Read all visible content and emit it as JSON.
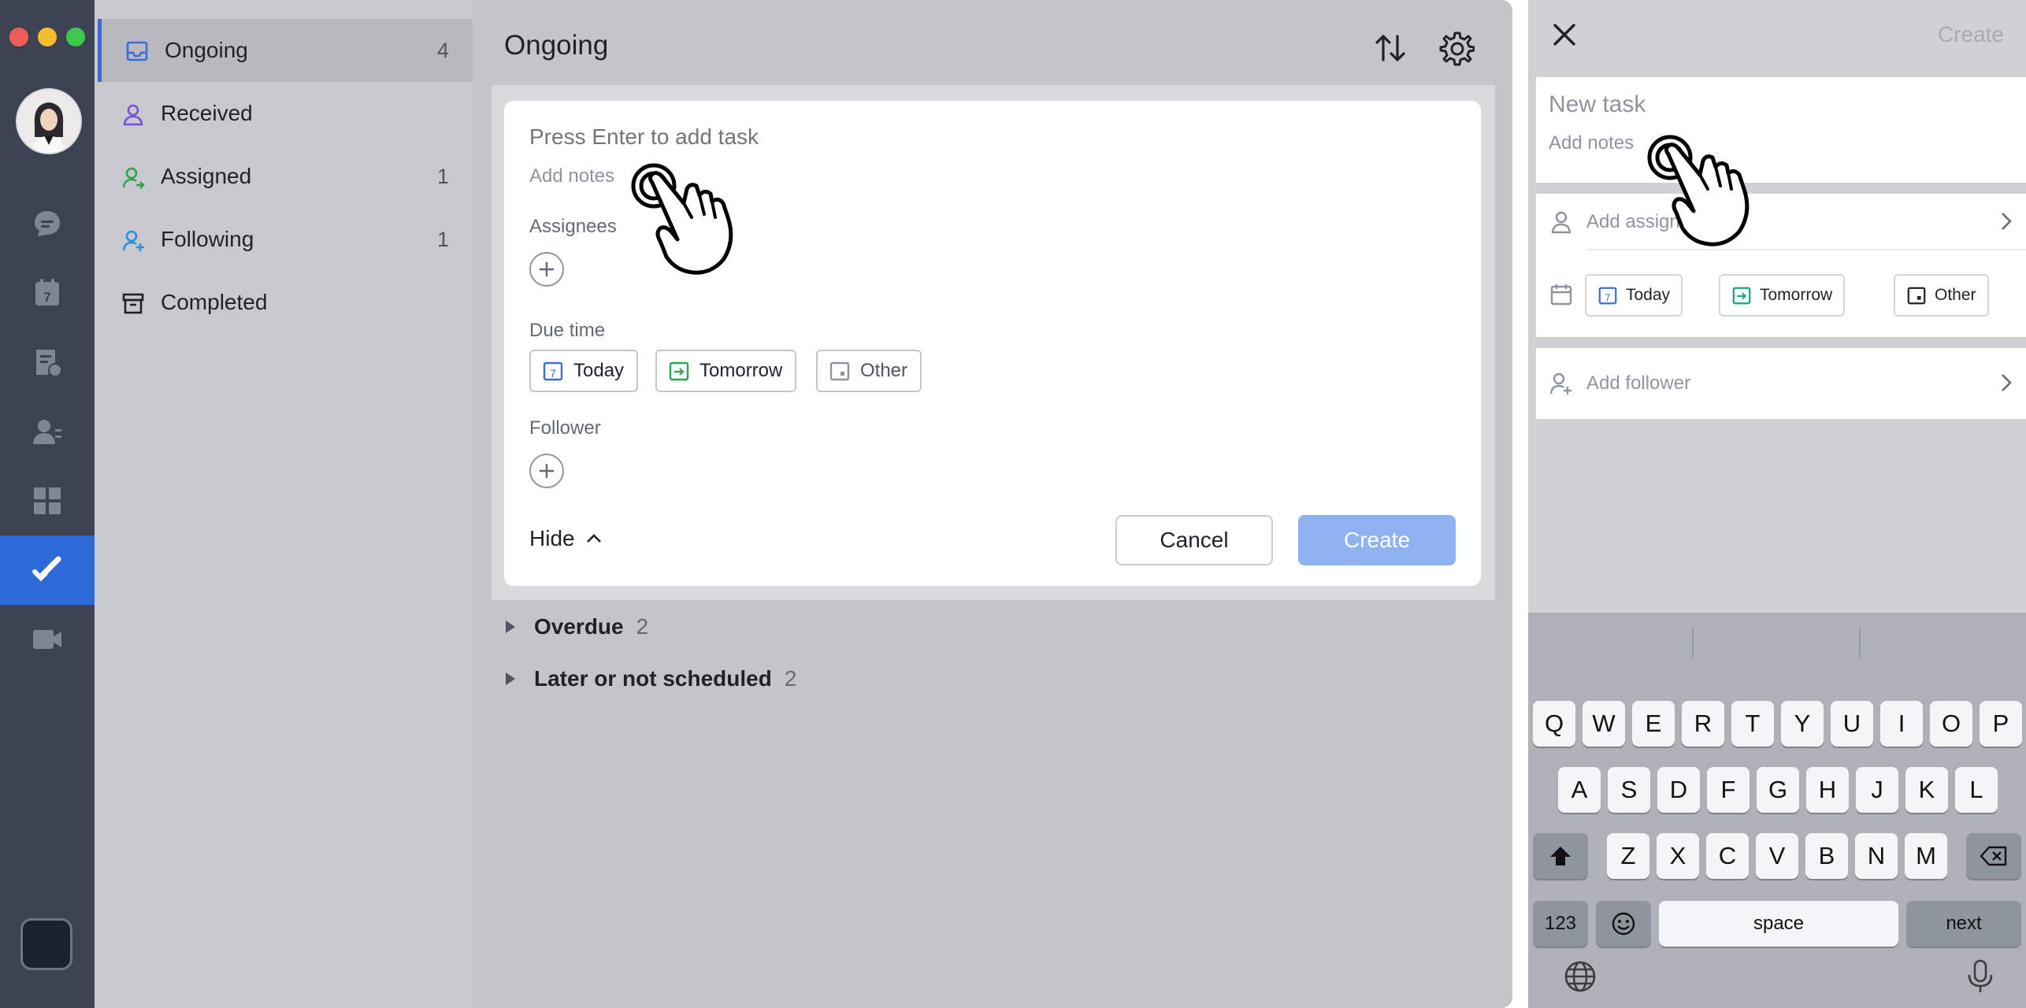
{
  "desktop": {
    "sidebar": {
      "items": [
        {
          "label": "Ongoing",
          "count": "4"
        },
        {
          "label": "Received",
          "count": ""
        },
        {
          "label": "Assigned",
          "count": "1"
        },
        {
          "label": "Following",
          "count": "1"
        },
        {
          "label": "Completed",
          "count": ""
        }
      ]
    },
    "main": {
      "title": "Ongoing",
      "form": {
        "task_placeholder": "Press Enter to add task",
        "notes_placeholder": "Add notes",
        "assignees_label": "Assignees",
        "due_time_label": "Due time",
        "due_options": [
          "Today",
          "Tomorrow",
          "Other"
        ],
        "follower_label": "Follower",
        "hide_label": "Hide",
        "cancel_label": "Cancel",
        "create_label": "Create"
      },
      "groups": [
        {
          "name": "Overdue",
          "count": "2"
        },
        {
          "name": "Later or not scheduled",
          "count": "2"
        }
      ]
    },
    "colors": {
      "accent": "#2e6ad7",
      "create_button": "#8fb3f0",
      "rail": "#3b4352"
    }
  },
  "mobile": {
    "header": {
      "create_label": "Create"
    },
    "title_placeholder": "New task",
    "notes_placeholder": "Add notes",
    "assignee_label": "Add assignee",
    "due_options": [
      "Today",
      "Tomorrow",
      "Other"
    ],
    "follower_label": "Add follower",
    "keyboard": {
      "row1": [
        "Q",
        "W",
        "E",
        "R",
        "T",
        "Y",
        "U",
        "I",
        "O",
        "P"
      ],
      "row2": [
        "A",
        "S",
        "D",
        "F",
        "G",
        "H",
        "J",
        "K",
        "L"
      ],
      "row3": [
        "Z",
        "X",
        "C",
        "V",
        "B",
        "N",
        "M"
      ],
      "numbers_key": "123",
      "space_key": "space",
      "next_key": "next"
    }
  }
}
